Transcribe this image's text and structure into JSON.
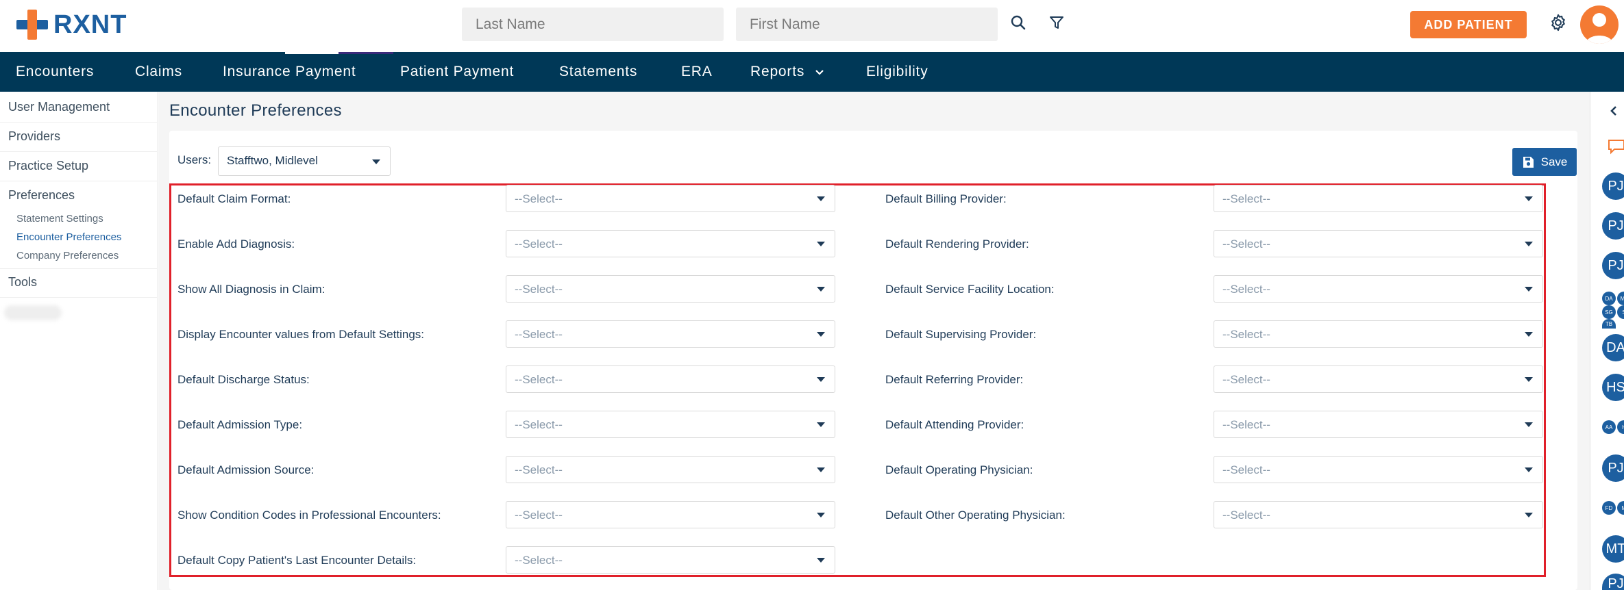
{
  "header": {
    "logo_text": "RXNT",
    "last_name_placeholder": "Last Name",
    "first_name_placeholder": "First Name",
    "add_patient_label": "ADD PATIENT"
  },
  "nav": {
    "items": [
      "Encounters",
      "Claims",
      "Insurance Payment",
      "Patient Payment",
      "Statements",
      "ERA",
      "Reports",
      "Eligibility"
    ]
  },
  "sidebar": {
    "items": [
      "User Management",
      "Providers",
      "Practice Setup",
      "Preferences",
      "Tools"
    ],
    "sub_items": [
      "Statement Settings",
      "Encounter Preferences",
      "Company Preferences"
    ]
  },
  "page": {
    "title": "Encounter Preferences",
    "users_label": "Users:",
    "users_value": "Stafftwo, Midlevel",
    "save_label": "Save"
  },
  "form": {
    "select_placeholder": "--Select--",
    "left_fields": [
      "Default Claim Format:",
      "Enable Add Diagnosis:",
      "Show All Diagnosis in Claim:",
      "Display Encounter values from Default Settings:",
      "Default Discharge Status:",
      "Default Admission Type:",
      "Default Admission Source:",
      "Show Condition Codes in Professional Encounters:",
      "Default Copy Patient's Last Encounter Details:"
    ],
    "right_fields": [
      "Default Billing Provider:",
      "Default Rendering Provider:",
      "Default Service Facility Location:",
      "Default Supervising Provider:",
      "Default Referring Provider:",
      "Default Attending Provider:",
      "Default Operating Physician:",
      "Default Other Operating Physician:"
    ]
  },
  "right_panel": {
    "avatars": [
      "PJ",
      "PJ",
      "PJ",
      "DA",
      "MJ",
      "SG",
      "S",
      "TB",
      "DA",
      "HS",
      "AA",
      "H",
      "PJ",
      "FD",
      "M",
      "MT",
      "PJ"
    ]
  },
  "colors": {
    "nav_bg": "#003857",
    "accent_orange": "#f47a33",
    "brand_blue": "#1d5fa0",
    "highlight_red": "#e0202a"
  }
}
